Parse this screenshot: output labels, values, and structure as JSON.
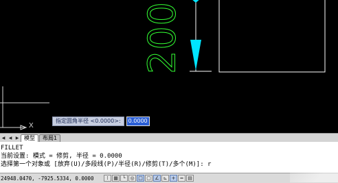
{
  "drawing": {
    "dimension_text": "200",
    "ucs_x_label": "X"
  },
  "dynamic_input": {
    "prompt": "指定圆角半径 <0.0000>:",
    "value": "0.0000"
  },
  "layout_tabs": [
    {
      "label": "模型",
      "active": true
    },
    {
      "label": "布局1",
      "active": false
    }
  ],
  "command_line": {
    "lines": [
      "FILLET",
      "当前设置: 模式 = 修剪, 半径 = 0.0000",
      "选择第一个对象或 [放弃(U)/多段线(P)/半径(R)/修剪(T)/多个(M)]: r"
    ]
  },
  "status_bar": {
    "coordinates": "24948.0470, -7925.5334, 0.0000"
  },
  "colors": {
    "background": "#000000",
    "dimension": "#33ff33",
    "arrow": "#00e5ff",
    "geometry": "#ffffff"
  }
}
